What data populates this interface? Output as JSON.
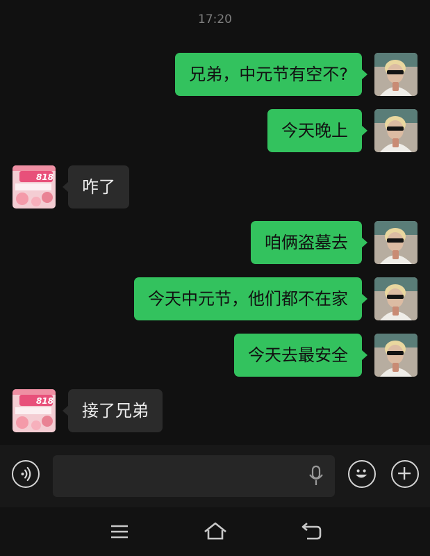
{
  "chat": {
    "timestamp": "17:20",
    "messages": [
      {
        "side": "out",
        "text": "兄弟，中元节有空不?"
      },
      {
        "side": "out",
        "text": "今天晚上"
      },
      {
        "side": "in",
        "text": "咋了"
      },
      {
        "side": "out",
        "text": "咱俩盗墓去"
      },
      {
        "side": "out",
        "text": "今天中元节，他们都不在家"
      },
      {
        "side": "out",
        "text": "今天去最安全"
      },
      {
        "side": "in",
        "text": "接了兄弟"
      }
    ]
  },
  "avatars": {
    "contact_badge": "818"
  },
  "input_bar": {
    "placeholder": "",
    "icons": [
      "voice-mode-icon",
      "microphone-icon",
      "emoji-icon",
      "plus-icon"
    ]
  },
  "navbar": {
    "icons": [
      "menu-icon",
      "home-icon",
      "back-icon"
    ]
  },
  "colors": {
    "background": "#111111",
    "outgoing_bubble": "#33c25e",
    "incoming_bubble": "#2b2b2b"
  }
}
